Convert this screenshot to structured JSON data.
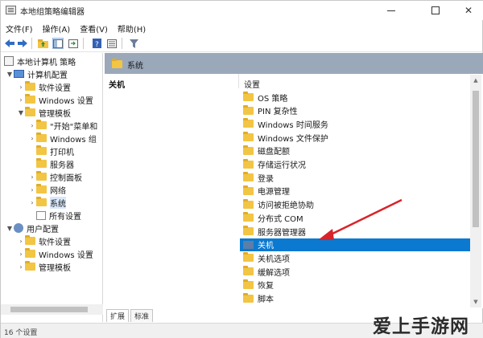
{
  "window": {
    "title": "本地组策略编辑器",
    "min_glyph": "",
    "max_glyph": "",
    "close_glyph": "✕"
  },
  "menu": [
    "文件(F)",
    "操作(A)",
    "查看(V)",
    "帮助(H)"
  ],
  "tree": {
    "root": "本地计算机 策略",
    "computer": "计算机配置",
    "software": "软件设置",
    "windows_settings": "Windows 设置",
    "admin_templates": "管理模板",
    "start_menu": "\"开始\"菜单和",
    "windows_components": "Windows 组",
    "printers": "打印机",
    "server": "服务器",
    "control_panel": "控制面板",
    "network": "网络",
    "system": "系统",
    "all_settings": "所有设置",
    "user": "用户配置",
    "user_software": "软件设置",
    "user_windows": "Windows 设置",
    "user_admin": "管理模板"
  },
  "right": {
    "header_title": "系统",
    "pane_title": "关机",
    "column_header": "设置",
    "items": [
      "OS 策略",
      "PIN 复杂性",
      "Windows 时间服务",
      "Windows 文件保护",
      "磁盘配额",
      "存储运行状况",
      "登录",
      "电源管理",
      "访问被拒绝协助",
      "分布式 COM",
      "服务器管理器",
      "关机",
      "关机选项",
      "缓解选项",
      "恢复",
      "脚本"
    ],
    "selected_index": 11
  },
  "tabs": [
    "扩展",
    "标准"
  ],
  "status": "16 个设置",
  "watermark": "爱上手游网",
  "colors": {
    "selection": "#0b79d0",
    "header_band": "#9aa8ba",
    "folder": "#f2c544",
    "annotation_arrow": "#d9232a"
  }
}
